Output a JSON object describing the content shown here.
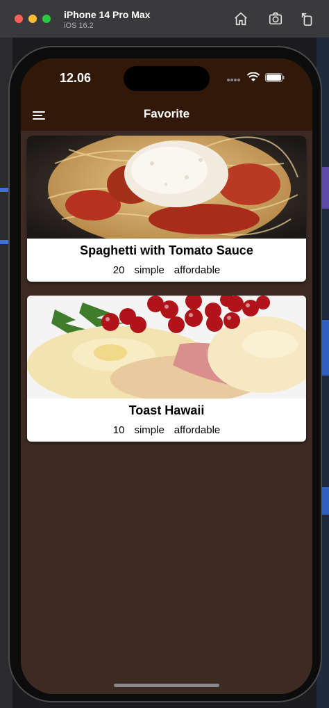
{
  "simulator": {
    "device_name": "iPhone 14 Pro Max",
    "os_version": "iOS 16.2",
    "buttons": [
      "home-icon",
      "screenshot-icon",
      "rotate-icon"
    ]
  },
  "status_bar": {
    "time": "12.06"
  },
  "app_bar": {
    "title": "Favorite",
    "menu_icon": "hamburger-menu-icon"
  },
  "colors": {
    "app_bar": "#311808",
    "body": "#3d2b23",
    "card": "#ffffff"
  },
  "meals": [
    {
      "title": "Spaghetti with Tomato Sauce",
      "duration": "20",
      "complexity": "simple",
      "affordability": "affordable"
    },
    {
      "title": "Toast Hawaii",
      "duration": "10",
      "complexity": "simple",
      "affordability": "affordable"
    }
  ]
}
